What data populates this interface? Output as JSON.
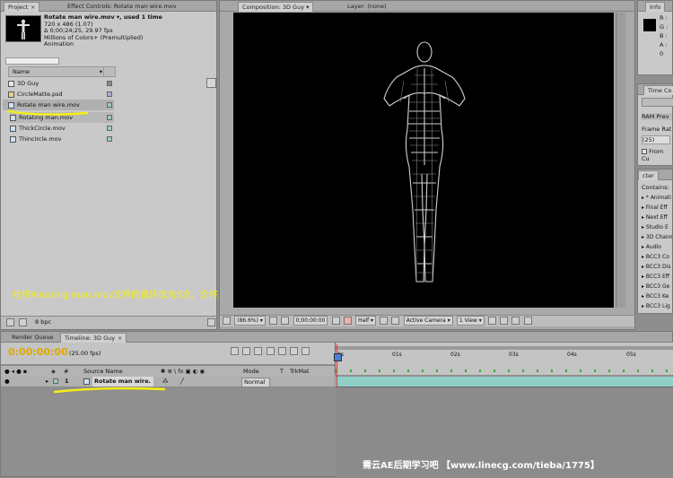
{
  "project_panel": {
    "tabs": [
      "Project",
      "Effect Controls: Rotate man wire.mov"
    ],
    "close_glyph": "×",
    "info": {
      "title": "Rotate man wire.mov ▾, used 1 time",
      "size": "720 x 486 (1.07)",
      "duration": "Δ 0;00;24;25, 29.97 fps",
      "colors": "Millions of Colors+ (Premultiplied)",
      "codec": "Animation"
    },
    "name_header": "Name",
    "items": [
      {
        "name": "3D Guy",
        "swatch": "#8a8a8a",
        "icon": "composition-icon"
      },
      {
        "name": "CircleMatte.psd",
        "swatch": "#b8a6d6",
        "icon": "photoshop-file-icon"
      },
      {
        "name": "Rotate man wire.mov",
        "swatch": "#9fc7b7",
        "icon": "footage-icon"
      },
      {
        "name": "Rotating man.mov",
        "swatch": "#9fc7b7",
        "icon": "footage-icon"
      },
      {
        "name": "ThickCircle.mov",
        "swatch": "#9fc7b7",
        "icon": "footage-icon"
      },
      {
        "name": "Thincircle.mov",
        "swatch": "#9fc7b7",
        "icon": "footage-icon"
      }
    ],
    "bpc": "8 bpc"
  },
  "annotation": "也将Rotating man.mov文件的循环改为5次，交将上面的文件拖入到时间线。",
  "comp_panel": {
    "tab_comp": "Composition: 3D Guy",
    "tab_layer": "Layer: (none)",
    "zoom": "(86.6%)",
    "timecode": "0;00:00:00",
    "resolution": "Half",
    "camera": "Active Camera",
    "view": "1 View"
  },
  "info_panel": {
    "tab": "Info",
    "channels": [
      "R :",
      "G :",
      "B :",
      "A : 0"
    ],
    "color_preview": "#000000"
  },
  "time_controls": {
    "tab": "Time Co",
    "ram_preview": "RAM Prev",
    "frame_rate_label": "Frame Rat",
    "frame_rate_value": "(25)",
    "from_current": "From Cu"
  },
  "effects_panel": {
    "tab": "cter",
    "contains_label": "Contains:",
    "items": [
      "* Animati",
      "Final Eff",
      "Next Eff",
      "Studio E",
      "3D Chann",
      "Audio",
      "BCC3 Co",
      "BCC3 Dis",
      "BCC3 Eff",
      "BCC3 Ge",
      "BCC3 Ke",
      "BCC3 Lig"
    ]
  },
  "timeline": {
    "tab_render": "Render Queue",
    "tab_timeline": "Timeline: 3D Guy",
    "timecode": "0:00:00:00",
    "fps": "(25.00 fps)",
    "columns": {
      "hash": "#",
      "source": "Source Name",
      "mode": "Mode",
      "t": "T",
      "trkmat": "TrkMat"
    },
    "layers": [
      {
        "index": "1",
        "name": "Rotate man wire.",
        "mode": "Normal"
      }
    ],
    "ruler_ticks": [
      "0s",
      "01s",
      "02s",
      "03s",
      "04s",
      "05s"
    ]
  },
  "watermark": "需云AE后期学习吧 【www.linecg.com/tieba/1775】"
}
